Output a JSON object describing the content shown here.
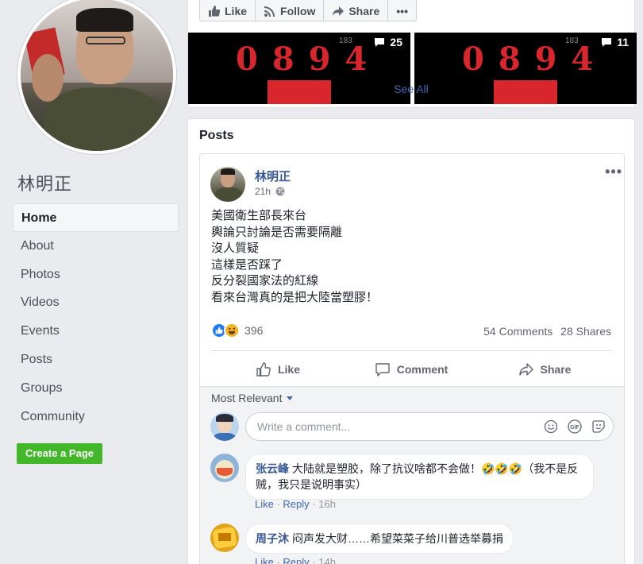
{
  "profile": {
    "name": "林明正"
  },
  "nav": {
    "items": [
      {
        "label": "Home",
        "active": true
      },
      {
        "label": "About"
      },
      {
        "label": "Photos"
      },
      {
        "label": "Videos"
      },
      {
        "label": "Events"
      },
      {
        "label": "Posts"
      },
      {
        "label": "Groups"
      },
      {
        "label": "Community"
      }
    ],
    "create_page": "Create a Page"
  },
  "top_card": {
    "actions": {
      "like": "Like",
      "follow": "Follow",
      "share": "Share",
      "more": "•••"
    },
    "thumbnails": [
      {
        "number": "0894",
        "faint": "183",
        "comments": "25"
      },
      {
        "number": "0894",
        "faint": "183",
        "comments": "11"
      }
    ],
    "see_all": "See All"
  },
  "posts": {
    "title": "Posts",
    "post": {
      "author": "林明正",
      "time": "21h",
      "more": "•••",
      "lines": [
        "美國衛生部長來台",
        "輿論只討論是否需要隔離",
        "沒人質疑",
        "這樣是否踩了",
        "反分裂國家法的紅線",
        "看來台灣真的是把大陸當塑膠！"
      ],
      "reaction_count": "396",
      "comments_count": "54 Comments",
      "shares_count": "28 Shares",
      "actions": {
        "like": "Like",
        "comment": "Comment",
        "share": "Share"
      },
      "comments_section": {
        "sort": "Most Relevant",
        "input_placeholder": "Write a comment...",
        "comments": [
          {
            "name": "张云峰",
            "text": "大陆就是塑胶，除了抗议啥都不会做！🤣🤣🤣（我不是反贼，我只是说明事实）",
            "like": "Like",
            "reply": "Reply",
            "time": "16h"
          },
          {
            "name": "周子沐",
            "text": "闷声发大财……希望菜菜子给川普选举募捐",
            "like": "Like",
            "reply": "Reply",
            "time": "14h"
          }
        ]
      }
    }
  },
  "colors": {
    "brand_blue": "#4267b2",
    "link_blue": "#385898",
    "green": "#42b72a",
    "bg": "#e9ebee"
  }
}
